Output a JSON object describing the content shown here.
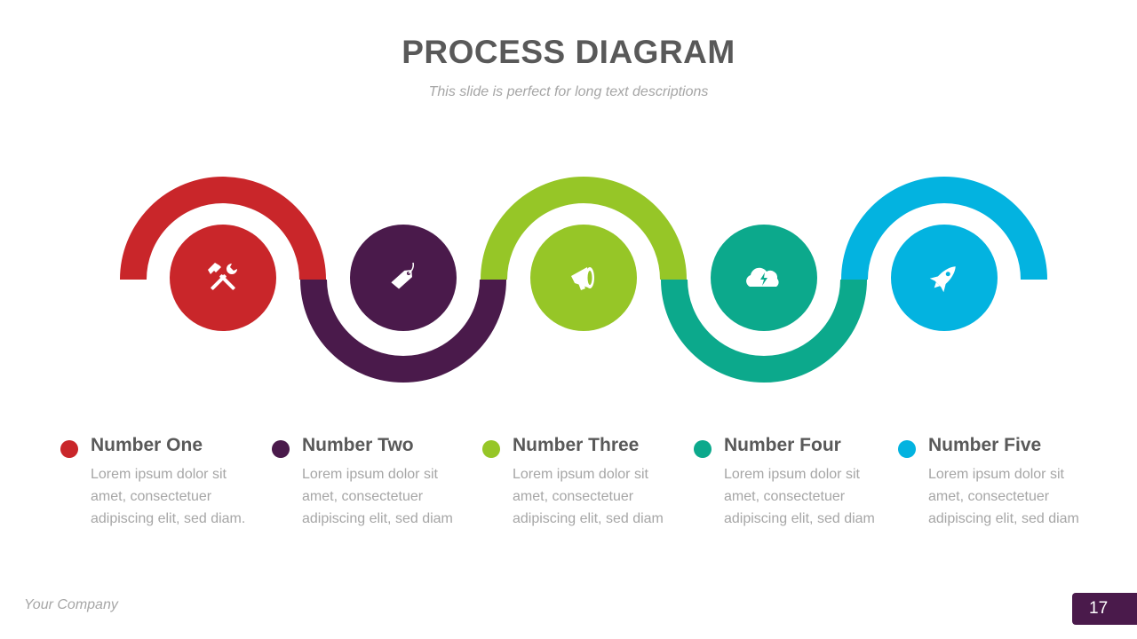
{
  "header": {
    "title": "PROCESS DIAGRAM",
    "subtitle": "This slide is perfect for long text descriptions"
  },
  "steps": [
    {
      "heading": "Number One",
      "description": "Lorem ipsum dolor sit amet, consectetuer adipiscing elit, sed diam.",
      "icon": "tools-icon",
      "color": "#c9262a",
      "arc": "top"
    },
    {
      "heading": "Number Two",
      "description": "Lorem ipsum dolor sit amet, consectetuer adipiscing elit, sed diam",
      "icon": "price-tag-icon",
      "color": "#4a1a4b",
      "arc": "bottom"
    },
    {
      "heading": "Number Three",
      "description": "Lorem ipsum dolor sit amet, consectetuer adipiscing elit, sed diam",
      "icon": "megaphone-icon",
      "color": "#96c627",
      "arc": "top"
    },
    {
      "heading": "Number Four",
      "description": "Lorem ipsum dolor sit amet, consectetuer adipiscing elit, sed diam",
      "icon": "cloud-lightning-icon",
      "color": "#0ca98c",
      "arc": "bottom"
    },
    {
      "heading": "Number Five",
      "description": "Lorem ipsum dolor sit amet, consectetuer adipiscing elit, sed diam",
      "icon": "rocket-icon",
      "color": "#03b3e0",
      "arc": "top"
    }
  ],
  "footer": {
    "company": "Your Company",
    "page_number": "17"
  }
}
